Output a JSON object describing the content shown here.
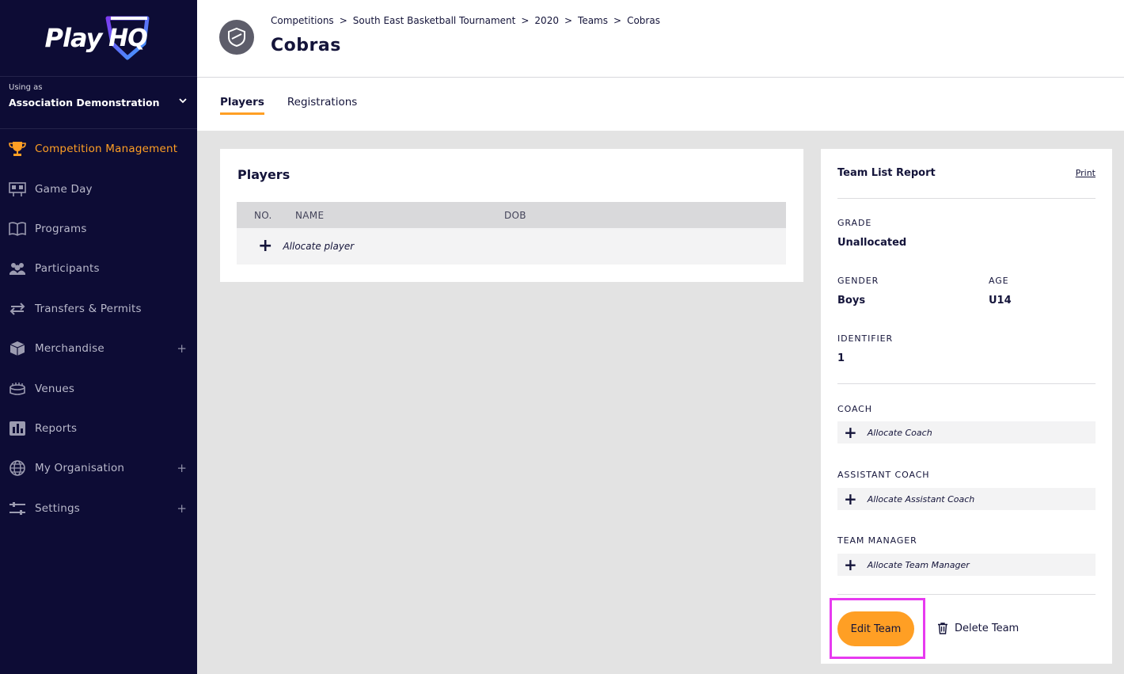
{
  "brand": {
    "logo_text": "Play",
    "logo_badge": "HQ",
    "accent": "#ff9f24",
    "sidebar_bg": "#0d0c35"
  },
  "user": {
    "using_label": "Using as",
    "org_name": "Association Demonstration"
  },
  "nav": [
    {
      "label": "Competition Management",
      "icon": "trophy-icon",
      "active": true
    },
    {
      "label": "Game Day",
      "icon": "scoreboard-icon"
    },
    {
      "label": "Programs",
      "icon": "book-icon"
    },
    {
      "label": "Participants",
      "icon": "people-icon"
    },
    {
      "label": "Transfers & Permits",
      "icon": "transfer-arrows-icon"
    },
    {
      "label": "Merchandise",
      "icon": "box-icon",
      "expandable": "+"
    },
    {
      "label": "Venues",
      "icon": "stadium-icon"
    },
    {
      "label": "Reports",
      "icon": "bar-chart-icon"
    },
    {
      "label": "My Organisation",
      "icon": "globe-icon",
      "expandable": "+"
    },
    {
      "label": "Settings",
      "icon": "sliders-icon",
      "expandable": "+"
    }
  ],
  "breadcrumb": [
    "Competitions",
    "South East Basketball Tournament",
    "2020",
    "Teams",
    "Cobras"
  ],
  "breadcrumb_sep": ">",
  "page_title": "Cobras",
  "tabs": [
    {
      "label": "Players",
      "active": true
    },
    {
      "label": "Registrations"
    }
  ],
  "players": {
    "title": "Players",
    "columns": [
      "NO.",
      "NAME",
      "DOB"
    ],
    "allocate_label": "Allocate player"
  },
  "report": {
    "title": "Team List Report",
    "print_label": "Print",
    "grade_label": "GRADE",
    "grade_value": "Unallocated",
    "gender_label": "GENDER",
    "gender_value": "Boys",
    "age_label": "AGE",
    "age_value": "U14",
    "identifier_label": "IDENTIFIER",
    "identifier_value": "1",
    "coach_label": "COACH",
    "coach_allocate": "Allocate Coach",
    "assistant_label": "ASSISTANT COACH",
    "assistant_allocate": "Allocate Assistant Coach",
    "manager_label": "TEAM MANAGER",
    "manager_allocate": "Allocate Team Manager",
    "edit_label": "Edit Team",
    "delete_label": "Delete Team"
  }
}
